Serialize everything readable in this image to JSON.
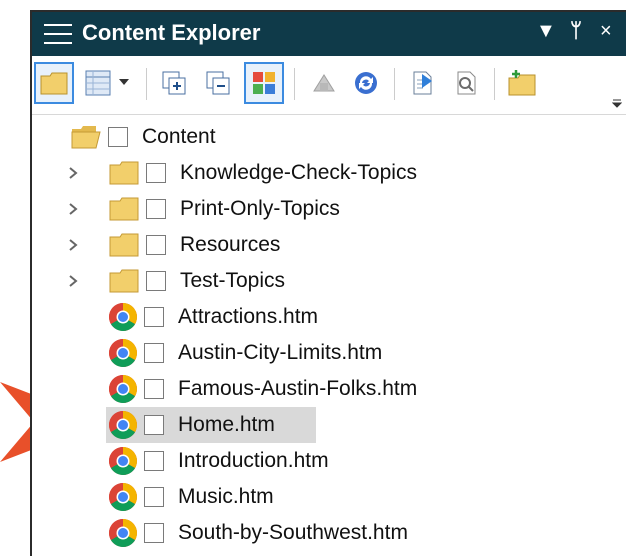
{
  "window": {
    "title": "Content Explorer",
    "controls": [
      "▼",
      "ᛘ",
      "×"
    ]
  },
  "toolbar": {
    "buttons": [
      {
        "icon": "folder-icon",
        "selected": true
      },
      {
        "icon": "grid-view-icon",
        "selected": false,
        "dropdown": true
      },
      {
        "icon": "expand-all-icon",
        "selected": false
      },
      {
        "icon": "collapse-all-icon",
        "selected": false
      },
      {
        "icon": "color-grid-icon",
        "selected": true
      },
      {
        "icon": "disabled-action-icon",
        "selected": false
      },
      {
        "icon": "refresh-icon",
        "selected": false
      },
      {
        "icon": "document-arrow-icon",
        "selected": false
      },
      {
        "icon": "document-search-icon",
        "selected": false
      },
      {
        "icon": "new-folder-icon",
        "selected": false
      }
    ]
  },
  "tree": {
    "root": {
      "label": "Content",
      "icon": "open-folder-icon"
    },
    "folders": [
      {
        "label": "Knowledge-Check-Topics"
      },
      {
        "label": "Print-Only-Topics"
      },
      {
        "label": "Resources"
      },
      {
        "label": "Test-Topics"
      }
    ],
    "files": [
      {
        "label": "Attractions.htm",
        "selected": false
      },
      {
        "label": "Austin-City-Limits.htm",
        "selected": false
      },
      {
        "label": "Famous-Austin-Folks.htm",
        "selected": false
      },
      {
        "label": "Home.htm",
        "selected": true
      },
      {
        "label": "Introduction.htm",
        "selected": false
      },
      {
        "label": "Music.htm",
        "selected": false
      },
      {
        "label": "South-by-Southwest.htm",
        "selected": false
      }
    ]
  },
  "colors": {
    "titlebar": "#0f3a49",
    "selection": "#d9d9d9",
    "callout_arrow": "#e8502a",
    "folder": "#f2cf6b"
  }
}
